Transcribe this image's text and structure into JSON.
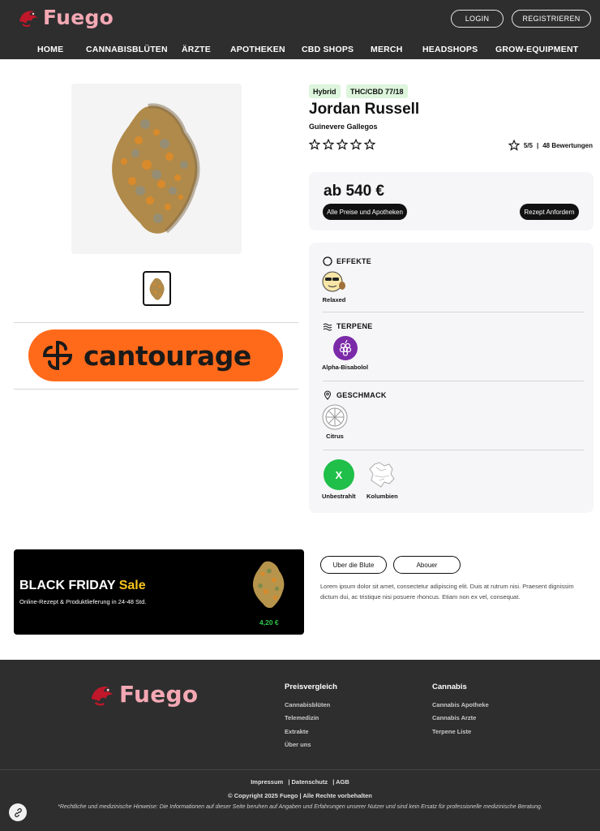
{
  "brand": {
    "name": "Fuego",
    "accent": "#f3a8b4"
  },
  "auth": {
    "login": "LOGIN",
    "register": "REGISTRIEREN"
  },
  "nav": [
    "HOME",
    "CANNABISBLÜTEN",
    "ÄRZTE",
    "APOTHEKEN",
    "CBD SHOPS",
    "MERCH",
    "HEADSHOPS",
    "GROW-EQUIPMENT"
  ],
  "sponsor": {
    "name": "cantourage",
    "color": "#ff6a1a"
  },
  "product": {
    "tags": [
      "Hybrid",
      "THC/CBD 77/18"
    ],
    "name": "Jordan Russell",
    "producer": "Guinevere Gallegos",
    "rating": "5/5",
    "reviews": "48 Bewertungen",
    "price": "ab 540 €",
    "prices_button": "Alle Preise und Apotheken",
    "prescription_button": "Rezept Anfordern"
  },
  "sections": {
    "effects": {
      "title": "EFFEKTE",
      "items": [
        "Relaxed"
      ]
    },
    "terpenes": {
      "title": "TERPENE",
      "items": [
        "Alpha-Bisabolol"
      ]
    },
    "taste": {
      "title": "GESCHMACK",
      "items": [
        "Citrus"
      ]
    },
    "origin": {
      "badge_letter": "X",
      "irradiation": "Unbestrahlt",
      "country": "Kolumbien"
    }
  },
  "promo": {
    "title": "BLACK FRIDAY",
    "highlight": "Sale",
    "subtitle": "Online-Rezept & Produktlieferung in 24-48 Std.",
    "price": "4,20 €"
  },
  "tabs": [
    "Uber die Blute",
    "Abouer"
  ],
  "description": "Lorem ipsum dolor sit amet, consectetur adipiscing elit. Duis at rutrum nisi. Praesent dignissim dictum dui, ac tristique nisi posuere rhoncus. Etiam non ex vel, consequat.",
  "footer": {
    "col1": {
      "title": "Preisvergleich",
      "links": [
        "Cannabisblüten",
        "Telemedizin",
        "Extrakte",
        "Über uns"
      ]
    },
    "col2": {
      "title": "Cannabis",
      "links": [
        "Cannabis Apotheke",
        "Cannabis Arzte",
        "Terpene Liste"
      ]
    },
    "legal": [
      "Impressum",
      "| Datenschutz",
      "| AGB"
    ],
    "copyright": "© Copyright 2025 Fuego | Alle Rechte vorbehalten",
    "disclaimer": "*Rechtliche und medizinische Hinweise: Die Informationen auf dieser Seite beruhen auf Angaben und Erfahrungen unserer Nutzer und sind kein Ersatz für professionelle medizinische Beratung."
  }
}
